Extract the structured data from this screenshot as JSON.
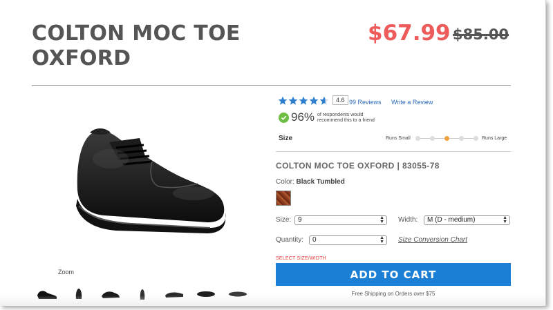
{
  "product": {
    "title_line1": "COLTON MOC TOE",
    "title_line2": "OXFORD",
    "price_sale": "$67.99",
    "price_original": "$85.00",
    "sku_line": "COLTON MOC TOE OXFORD | 83055-78"
  },
  "rating": {
    "stars": 4.6,
    "value": "4.6",
    "reviews_link": "99 Reviews",
    "write_link": "Write a Review",
    "recommend_pct": "96%",
    "recommend_text": "of respondents would recommend this to a friend"
  },
  "fit": {
    "label": "Size",
    "low_label": "Runs Small",
    "high_label": "Runs Large",
    "steps": 5,
    "selected_step": 3
  },
  "color": {
    "label": "Color:",
    "value": "Black Tumbled",
    "swatch_name": "brown-tumbled-swatch"
  },
  "options": {
    "size_label": "Size:",
    "size_value": "9",
    "width_label": "Width:",
    "width_value": "M (D - medium)",
    "quantity_label": "Quantity:",
    "quantity_value": "0",
    "size_chart_link": "Size Conversion Chart"
  },
  "cart": {
    "warning": "SELECT SIZE/WIDTH",
    "button_label": "ADD TO CART",
    "shipping_text": "Free Shipping on Orders over $75"
  },
  "gallery": {
    "zoom_label": "Zoom",
    "thumbnail_icons": [
      "side-view",
      "front-view",
      "angle-view",
      "back-view",
      "top-view",
      "pair-view",
      "sole-view"
    ]
  },
  "colors": {
    "sale_price": "#ee5b5b",
    "cart_button": "#1c7fd6",
    "star": "#2f7fd0",
    "check": "#6fbe44",
    "fit_active": "#f2a23c"
  }
}
